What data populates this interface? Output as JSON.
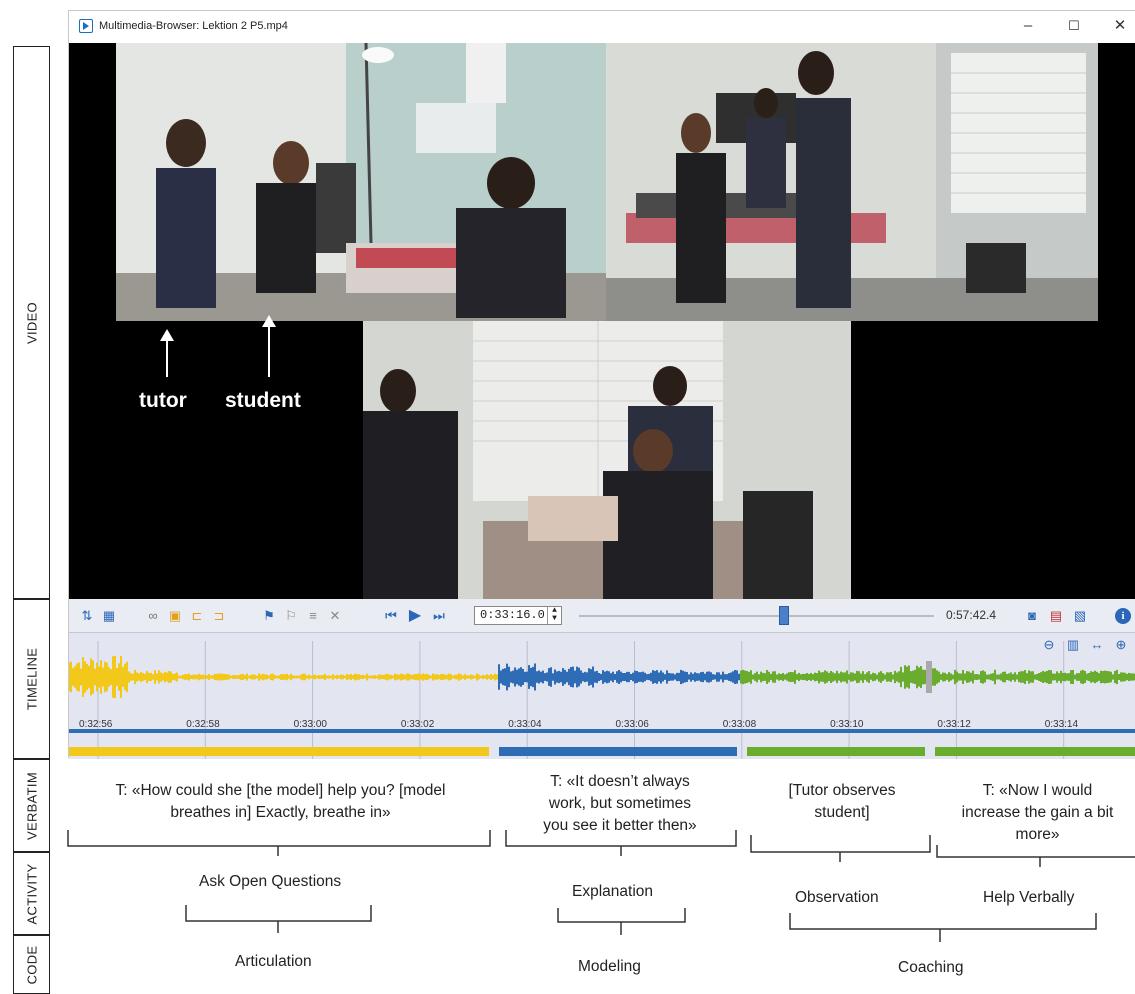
{
  "side_labels": {
    "video": "VIDEO",
    "timeline": "TIMELINE",
    "verbatim": "VERBATIM",
    "activity": "ACTIVITY",
    "code": "CODE"
  },
  "window": {
    "title": "Multimedia-Browser: Lektion 2 P5.mp4",
    "minimize": "–",
    "maximize": "☐",
    "close": "✕"
  },
  "video": {
    "annotations": {
      "tutor": "tutor",
      "student": "student"
    }
  },
  "player": {
    "current_time": "0:33:16.0",
    "total_time": "0:57:42.4",
    "position_fraction": 0.577
  },
  "timeline": {
    "ticks": [
      "0:32:56",
      "0:32:58",
      "0:33:00",
      "0:33:02",
      "0:33:04",
      "0:33:06",
      "0:33:08",
      "0:33:10",
      "0:33:12",
      "0:33:14"
    ],
    "segment_colors": {
      "yellow": "#f2c81a",
      "blue": "#2e6db5",
      "green": "#6aad2e"
    }
  },
  "verbatim": [
    {
      "line1": "T: «How could she [the model] help you? [model",
      "line2": "breathes in] Exactly, breathe in»",
      "line3": ""
    },
    {
      "line1": "T: «It doesn’t always",
      "line2": "work, but sometimes",
      "line3": "you see it better then»"
    },
    {
      "line1": "[Tutor observes",
      "line2": "student]",
      "line3": ""
    },
    {
      "line1": "T: «Now I would",
      "line2": "increase the gain a bit",
      "line3": "more»"
    }
  ],
  "activities": [
    "Ask Open Questions",
    "Explanation",
    "Observation",
    "Help Verbally"
  ],
  "codes": [
    "Articulation",
    "Modeling",
    "Coaching"
  ],
  "colors": {
    "accent": "#2b66b8",
    "timeline_bg": "#e3e5f1",
    "toolbar_bg": "#e9ecf3"
  }
}
